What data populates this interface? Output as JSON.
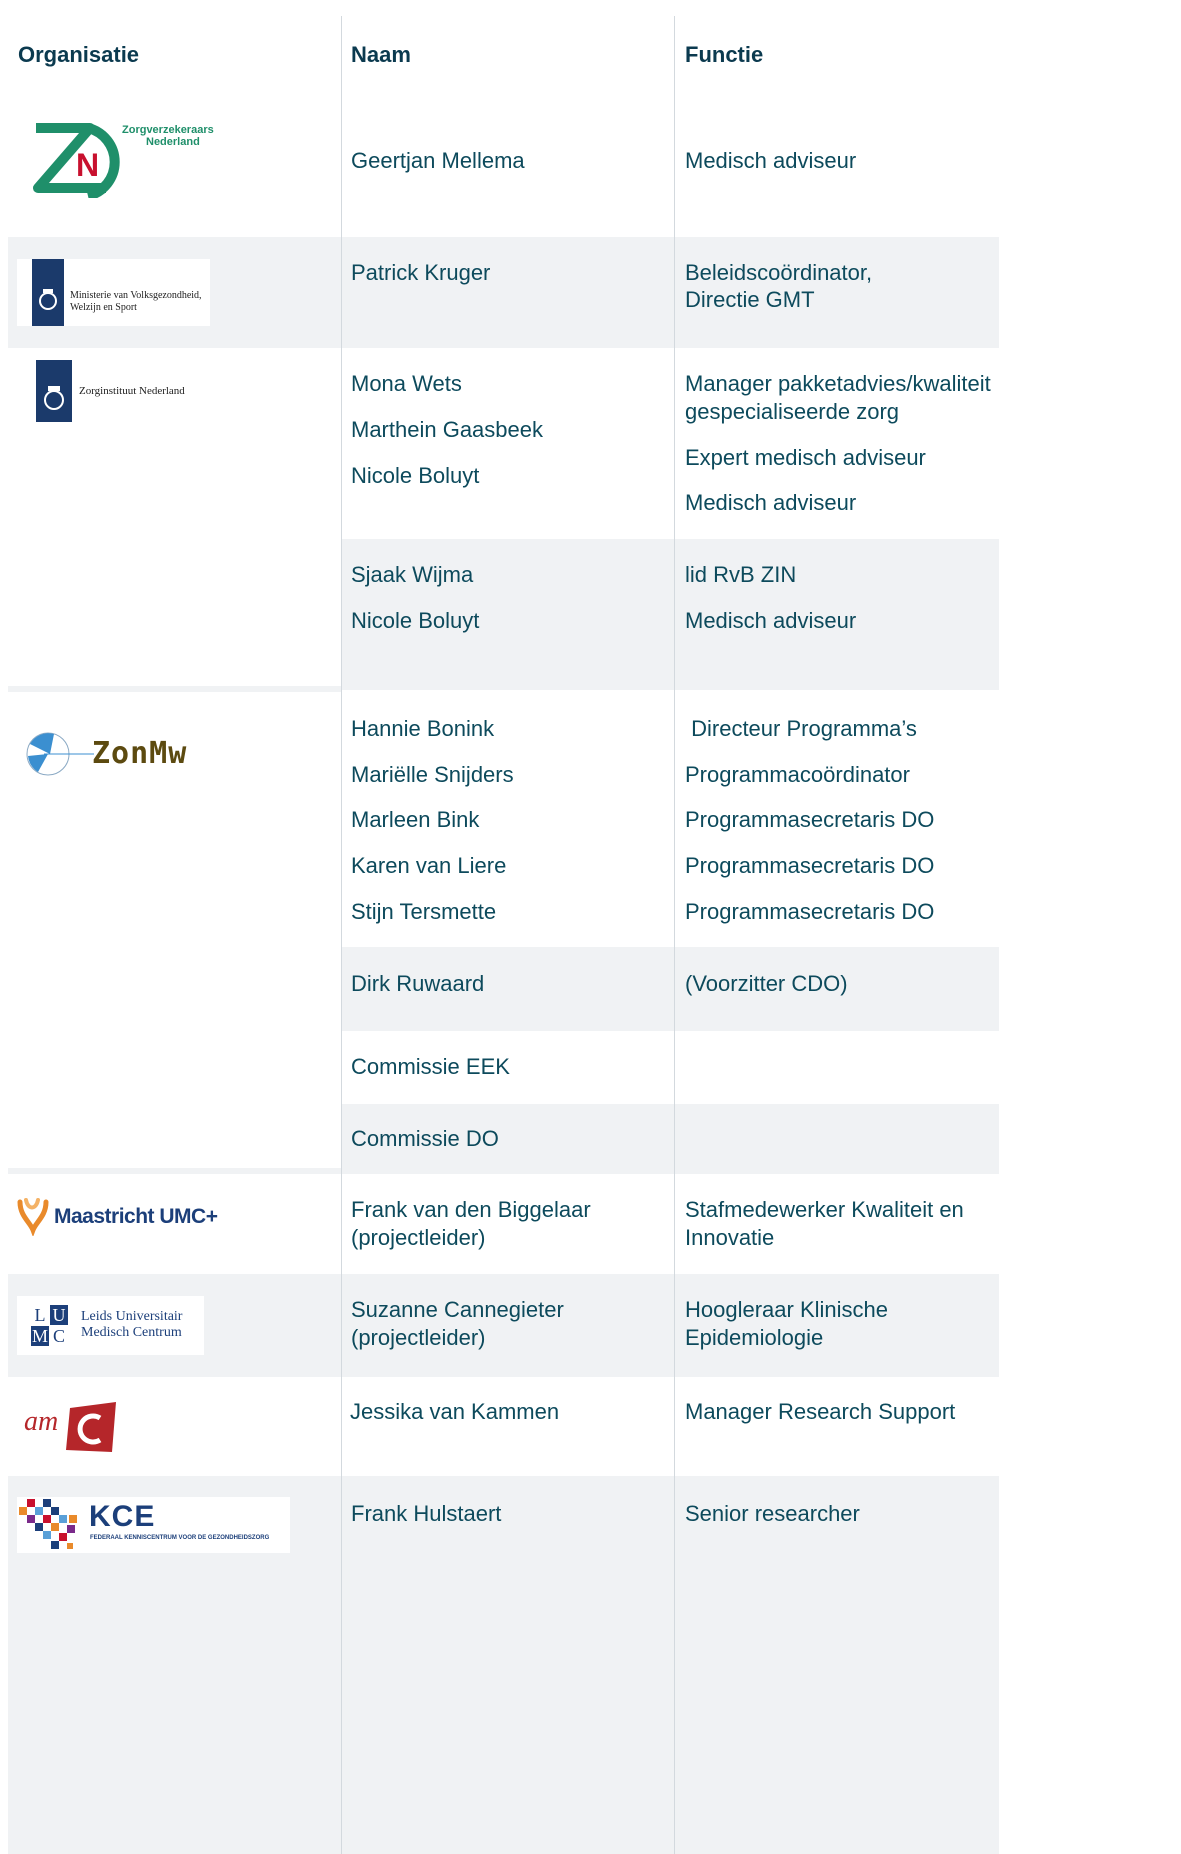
{
  "headers": {
    "organisatie": "Organisatie",
    "naam": "Naam",
    "functie": "Functie"
  },
  "logos": {
    "zn": {
      "line1": "Zorgverzekeraars",
      "line2": "Nederland",
      "mark": "N",
      "icon": "zn-logo"
    },
    "vws": {
      "line1": "Ministerie van Volksgezondheid,",
      "line2": "Welzijn en Sport",
      "icon": "rijksoverheid-crest"
    },
    "zin": {
      "line1": "Zorginstituut Nederland",
      "icon": "rijksoverheid-crest"
    },
    "zonmw": {
      "text": "ZonMw",
      "icon": "globe-icon"
    },
    "mumc": {
      "text": "Maastricht UMC+",
      "icon": "heart-ribbon-icon"
    },
    "lumc": {
      "letters": [
        "L",
        "U",
        "M",
        "C"
      ],
      "line1": "Leids Universitair",
      "line2": "Medisch Centrum"
    },
    "amc": {
      "text": "am",
      "mark": "C"
    },
    "kce": {
      "text": "KCE",
      "sub": "FEDERAAL KENNISCENTRUM VOOR DE GEZONDHEIDSZORG",
      "icon": "pixel-mosaic-icon"
    }
  },
  "rows": {
    "zn": {
      "names": [
        "Geertjan Mellema"
      ],
      "functions": [
        "Medisch adviseur"
      ]
    },
    "vws": {
      "names": [
        "Patrick Kruger"
      ],
      "functions": [
        "Beleidscoördinator,",
        "Directie GMT"
      ]
    },
    "zin1": {
      "names": [
        "Mona Wets",
        "Marthein Gaasbeek",
        "Nicole Boluyt"
      ],
      "functions": [
        "Manager pakketadvies/kwaliteit",
        "gespecialiseerde zorg",
        "Expert medisch adviseur",
        "Medisch adviseur"
      ]
    },
    "zin2": {
      "names": [
        "Sjaak Wijma",
        "Nicole Boluyt"
      ],
      "functions": [
        "lid RvB ZIN",
        "Medisch adviseur"
      ]
    },
    "zonmw1": {
      "names": [
        "Hannie Bonink",
        "Mariëlle Snijders",
        "Marleen Bink",
        "Karen van Liere",
        "Stijn Tersmette"
      ],
      "functions": [
        " Directeur Programma’s",
        "Programmacoördinator",
        "Programmasecretaris DO",
        "Programmasecretaris DO",
        "Programmasecretaris DO"
      ]
    },
    "zonmw2": {
      "names": [
        "Dirk Ruwaard"
      ],
      "functions": [
        "(Voorzitter CDO)"
      ]
    },
    "zonmw3": {
      "names": [
        "Commissie EEK"
      ]
    },
    "zonmw4": {
      "names": [
        "Commissie DO"
      ]
    },
    "mumc": {
      "names": [
        "Frank van den Biggelaar",
        "(projectleider)"
      ],
      "functions": [
        "Stafmedewerker Kwaliteit en",
        "Innovatie"
      ]
    },
    "lumc": {
      "names": [
        "Suzanne Cannegieter",
        "(projectleider)"
      ],
      "functions": [
        "Hoogleraar Klinische",
        "Epidemiologie"
      ]
    },
    "amc": {
      "names": [
        "Jessika van Kammen"
      ],
      "functions": [
        "Manager Research Support"
      ]
    },
    "kce": {
      "names": [
        "Frank Hulstaert"
      ],
      "functions": [
        "Senior researcher"
      ]
    }
  },
  "colors": {
    "text": "#0d4a5c",
    "header": "#0b3a4f",
    "band": "#f0f2f4",
    "zn_green": "#1f8f6a",
    "zn_red": "#c8102e",
    "rijk_blue": "#1b3a6b",
    "zonmw_olive": "#5c4a10",
    "mumc_blue": "#1c3f7a",
    "mumc_orange": "#e98a2b",
    "amc_red": "#b5262a"
  }
}
